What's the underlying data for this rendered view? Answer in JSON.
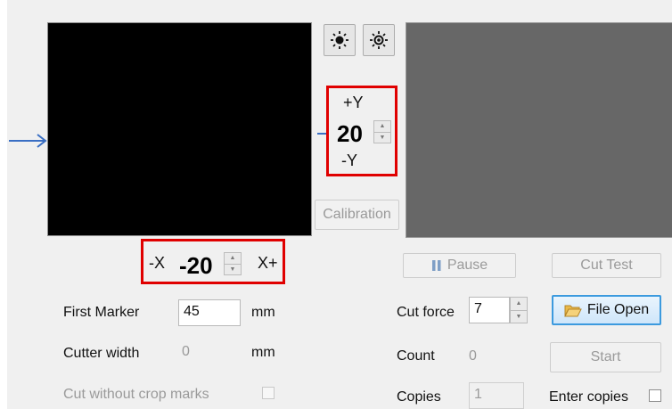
{
  "calibration_label": "Calibration",
  "y_offset": {
    "plus_label": "+Y",
    "value": "20",
    "minus_label": "-Y"
  },
  "x_offset": {
    "minus_label": "-X",
    "value": "-20",
    "plus_label": "X+"
  },
  "first_marker": {
    "label": "First Marker",
    "value": "45",
    "unit": "mm"
  },
  "cutter_width": {
    "label": "Cutter width",
    "value": "0",
    "unit": "mm"
  },
  "cut_without_crop_marks": {
    "label": "Cut without crop marks",
    "checked": false
  },
  "pause_label": "Pause",
  "cut_test_label": "Cut Test",
  "cut_force": {
    "label": "Cut force",
    "value": "7"
  },
  "file_open_label": "File Open",
  "count": {
    "label": "Count",
    "value": "0"
  },
  "start_label": "Start",
  "copies": {
    "label": "Copies",
    "value": "1"
  },
  "enter_copies": {
    "label": "Enter copies",
    "checked": false
  },
  "icons": {
    "brightness_low": "sun-small-icon",
    "brightness_high": "sun-large-icon",
    "left_arrow": "arrow-right-icon",
    "mid_arrow": "arrow-right-icon",
    "pause": "pause-icon",
    "folder": "folder-icon"
  }
}
